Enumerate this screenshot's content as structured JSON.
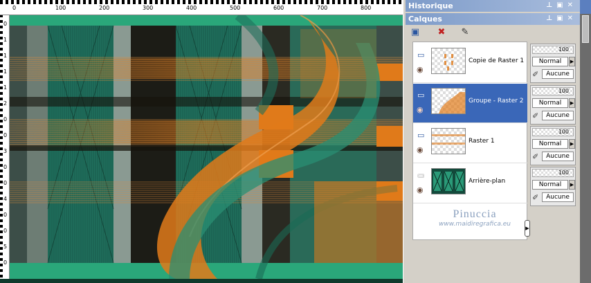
{
  "ruler": {
    "top_labels": [
      "0",
      "100",
      "200",
      "300",
      "400",
      "500",
      "600",
      "700",
      "800"
    ],
    "left_labels": [
      "0",
      "1",
      "1",
      "1",
      "1",
      "2",
      "0",
      "0",
      "3",
      "0",
      "0",
      "4",
      "0",
      "0",
      "5",
      "0"
    ]
  },
  "panels": {
    "historique_title": "Historique",
    "calques_title": "Calques"
  },
  "toolbar": {
    "new_layer_icon": "new-raster-layer-icon",
    "delete_icon": "delete-layer-icon",
    "edit_icon": "edit-selection-icon"
  },
  "layers": [
    {
      "name": "Copie de Raster 1",
      "opacity": "100",
      "blend": "Normal",
      "mask": "Aucune",
      "selected": false
    },
    {
      "name": "Groupe - Raster 2",
      "opacity": "100",
      "blend": "Normal",
      "mask": "Aucune",
      "selected": true
    },
    {
      "name": "Raster 1",
      "opacity": "100",
      "blend": "Normal",
      "mask": "Aucune",
      "selected": false
    },
    {
      "name": "Arrière-plan",
      "opacity": "100",
      "blend": "Normal",
      "mask": "Aucune",
      "selected": false
    }
  ],
  "watermark": {
    "name": "Pinuccia",
    "url": "www.maidiregrafica.eu"
  },
  "colors": {
    "teal": "#1f7a62",
    "orange": "#e07a1a",
    "dark": "#1a1a14",
    "selection": "#3a67b8"
  }
}
